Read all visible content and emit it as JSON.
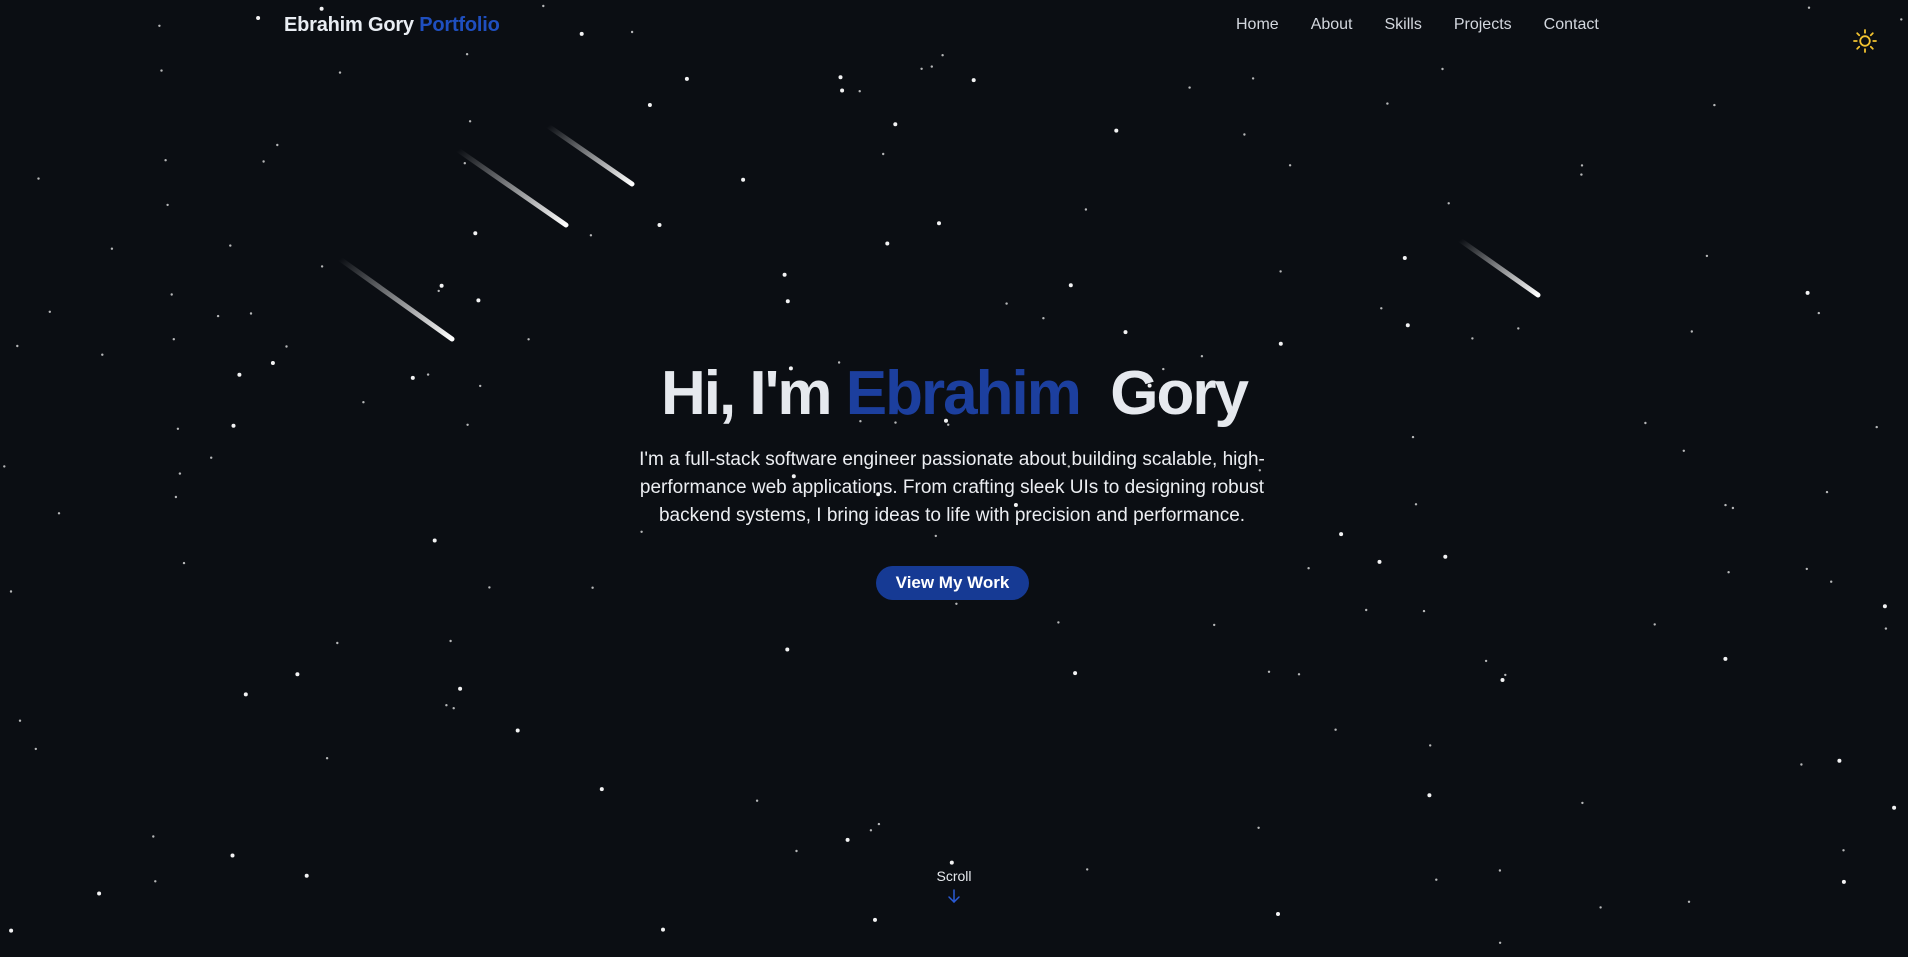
{
  "navbar": {
    "brand_name": "Ebrahim Gory",
    "brand_suffix": "Portfolio",
    "links": [
      {
        "label": "Home"
      },
      {
        "label": "About"
      },
      {
        "label": "Skills"
      },
      {
        "label": "Projects"
      },
      {
        "label": "Contact"
      }
    ],
    "theme_toggle_icon": "sun-icon"
  },
  "hero": {
    "greeting": "Hi, I'm",
    "first_name": "Ebrahim",
    "last_name": "Gory",
    "description": "I'm a full-stack software engineer passionate about building scalable, high-performance web applications. From crafting sleek UIs to designing robust backend systems, I bring ideas to life with precision and performance.",
    "cta_label": "View My Work"
  },
  "scroll": {
    "label": "Scroll",
    "icon": "arrow-down-icon"
  },
  "colors": {
    "background": "#0b0e13",
    "accent": "#1c3f9e",
    "button": "#163a94",
    "sun": "#f2c230"
  }
}
